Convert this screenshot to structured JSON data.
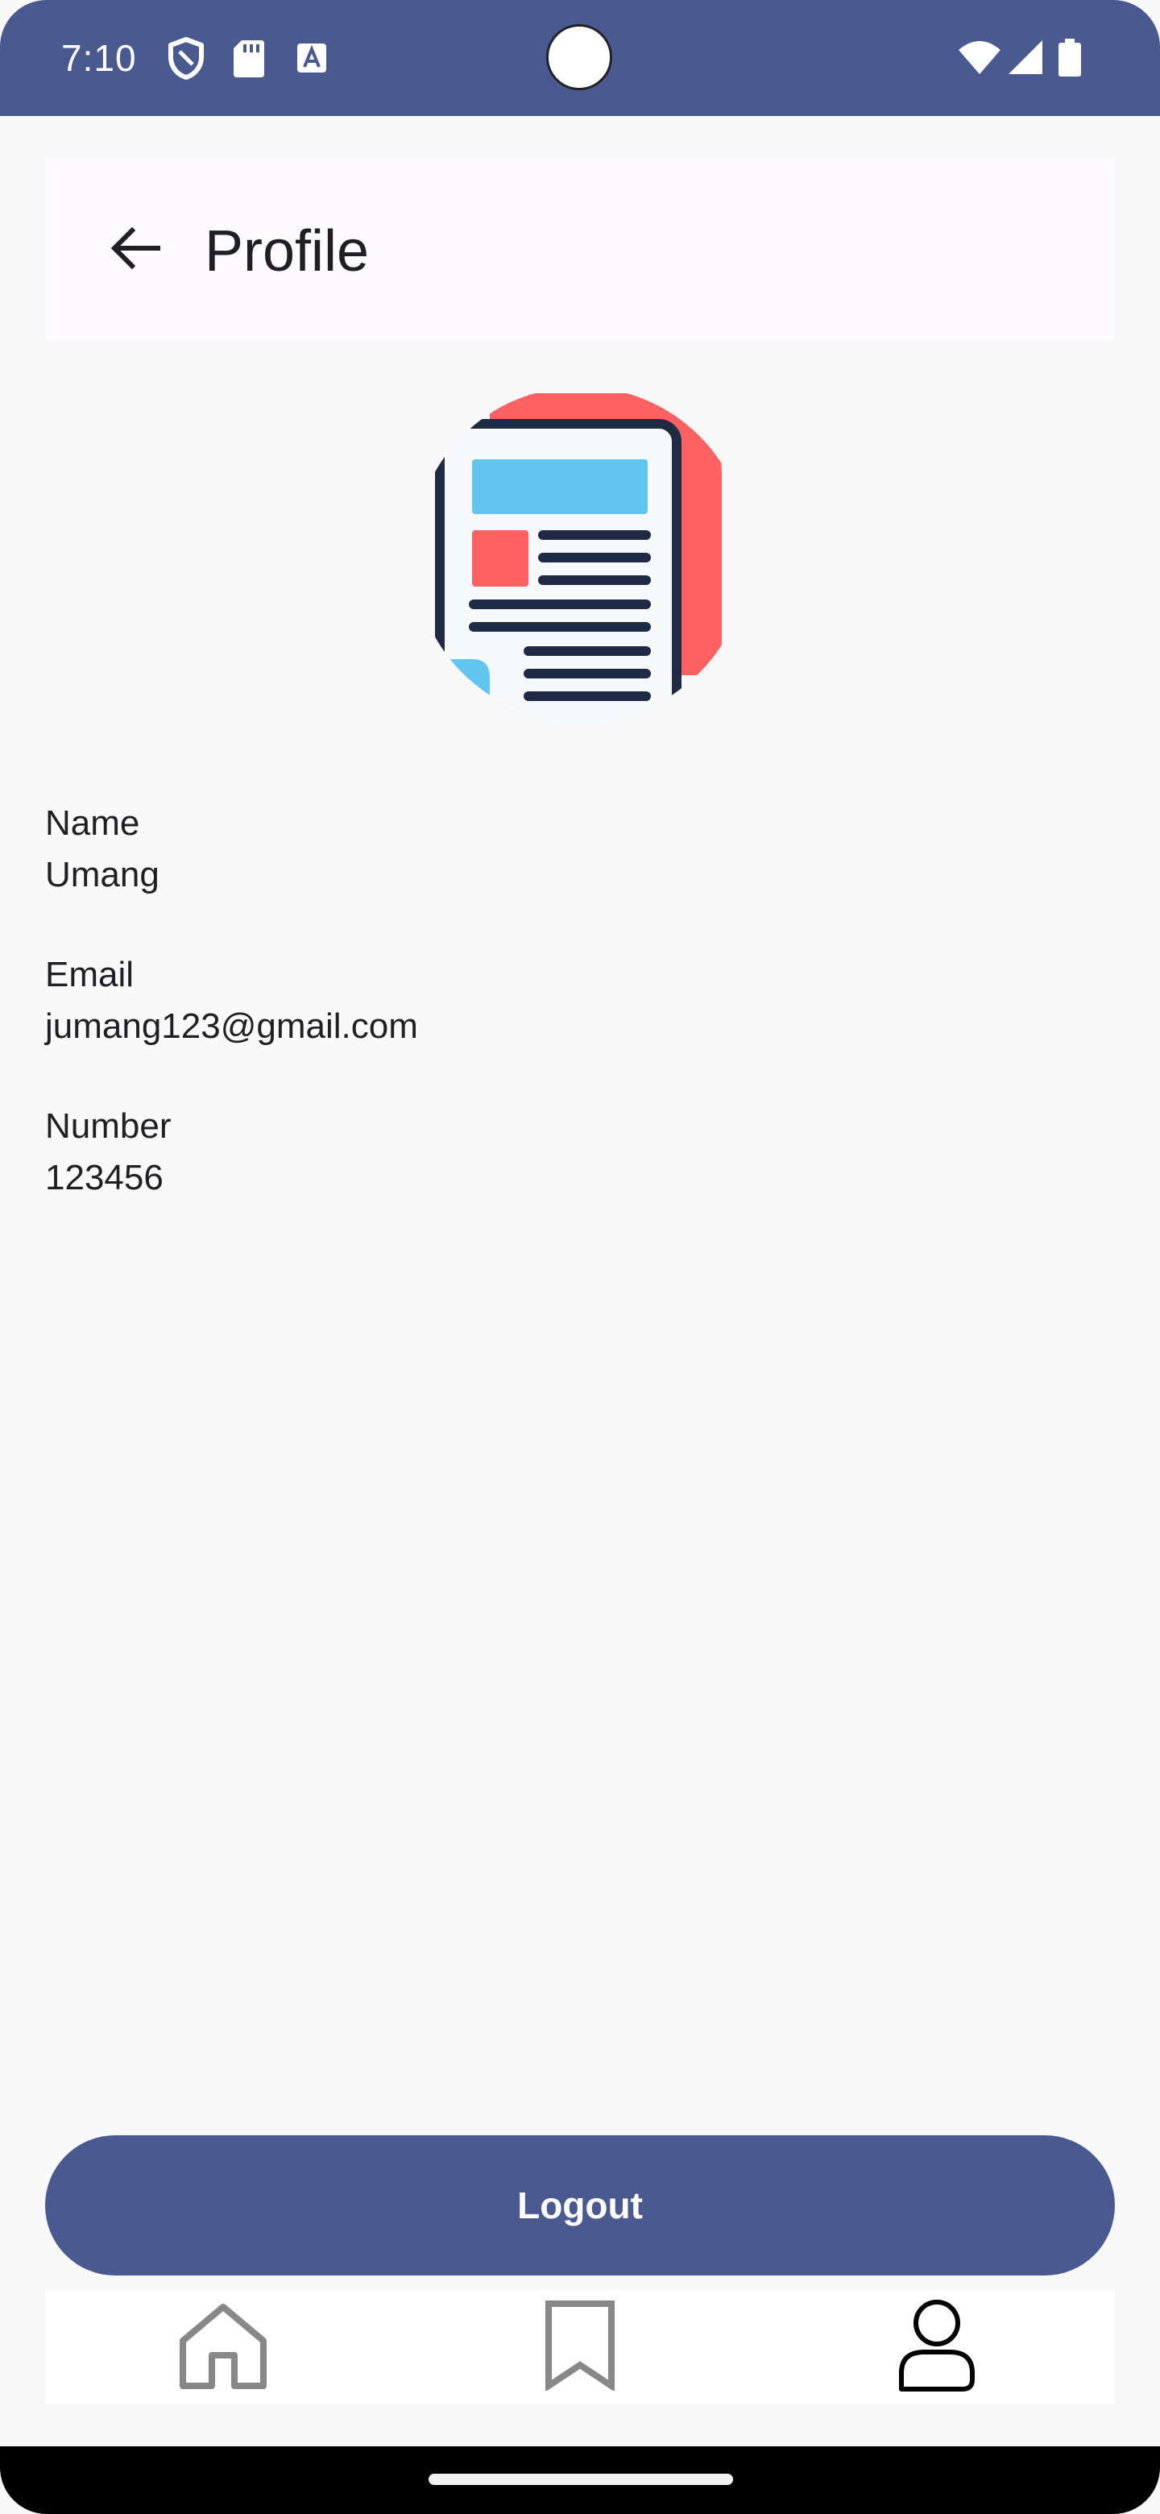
{
  "status_bar": {
    "time": "7:10",
    "icons": [
      "shield-icon",
      "sd-card-icon",
      "a-box-icon",
      "wifi-icon",
      "signal-icon",
      "battery-icon"
    ]
  },
  "app_bar": {
    "back_icon": "arrow-left-icon",
    "title": "Profile"
  },
  "avatar": {
    "icon": "newspaper-icon",
    "colors": {
      "accent_red": "#ff6262",
      "accent_blue": "#62c5ef",
      "outline": "#1f2b45"
    }
  },
  "profile": {
    "fields": [
      {
        "label": "Name",
        "value": "Umang"
      },
      {
        "label": "Email",
        "value": "jumang123@gmail.com"
      },
      {
        "label": "Number",
        "value": "123456"
      }
    ]
  },
  "logout": {
    "label": "Logout"
  },
  "bottom_nav": {
    "items": [
      {
        "icon": "home-icon",
        "active": false
      },
      {
        "icon": "bookmark-icon",
        "active": false
      },
      {
        "icon": "person-icon",
        "active": true
      }
    ]
  },
  "colors": {
    "primary": "#4a5a90",
    "background": "#f9f9fa"
  }
}
